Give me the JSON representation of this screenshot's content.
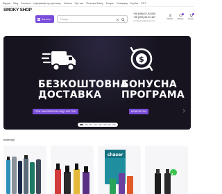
{
  "topbar": {
    "links": [
      "Відгуки",
      "Blog",
      "Контакти",
      "Інформація про доставку",
      "Новини",
      "Про нас",
      "Політика Safety",
      "Бонуси",
      "Співпраця",
      "Клубок",
      "ОПТ"
    ]
  },
  "header": {
    "logo": "SMOKY SHOP",
    "catalog_label": "Каталог",
    "search_placeholder": "Пошук",
    "phones": [
      "+38 (096) 07-93-005",
      "+38 (099) 39-21-187"
    ],
    "email": "smokyshop@gmail.com",
    "icons": [
      {
        "name": "user-icon",
        "label": "Кабінет"
      },
      {
        "name": "heart-icon",
        "label": "Обране"
      },
      {
        "name": "cart-icon",
        "label": "Кошик"
      }
    ]
  },
  "banner": {
    "left_title_1": "БЕЗКОШТОВНА",
    "left_title_2": "ДОСТАВКА",
    "left_pill": "ПРИ ЗАМОВЛЕННІ ВІД 1000 ГРН",
    "right_title_1": "БОНУСНА",
    "right_title_2": "ПРОГРАМА",
    "right_pill": "КЕШБЕК 5%",
    "slide_count": 8,
    "active_slide": 1
  },
  "section": {
    "title": "Категорії"
  },
  "colors": {
    "accent": "#7a4dd9",
    "banner_bg": "#17141f",
    "fab": "#3bc24f"
  }
}
